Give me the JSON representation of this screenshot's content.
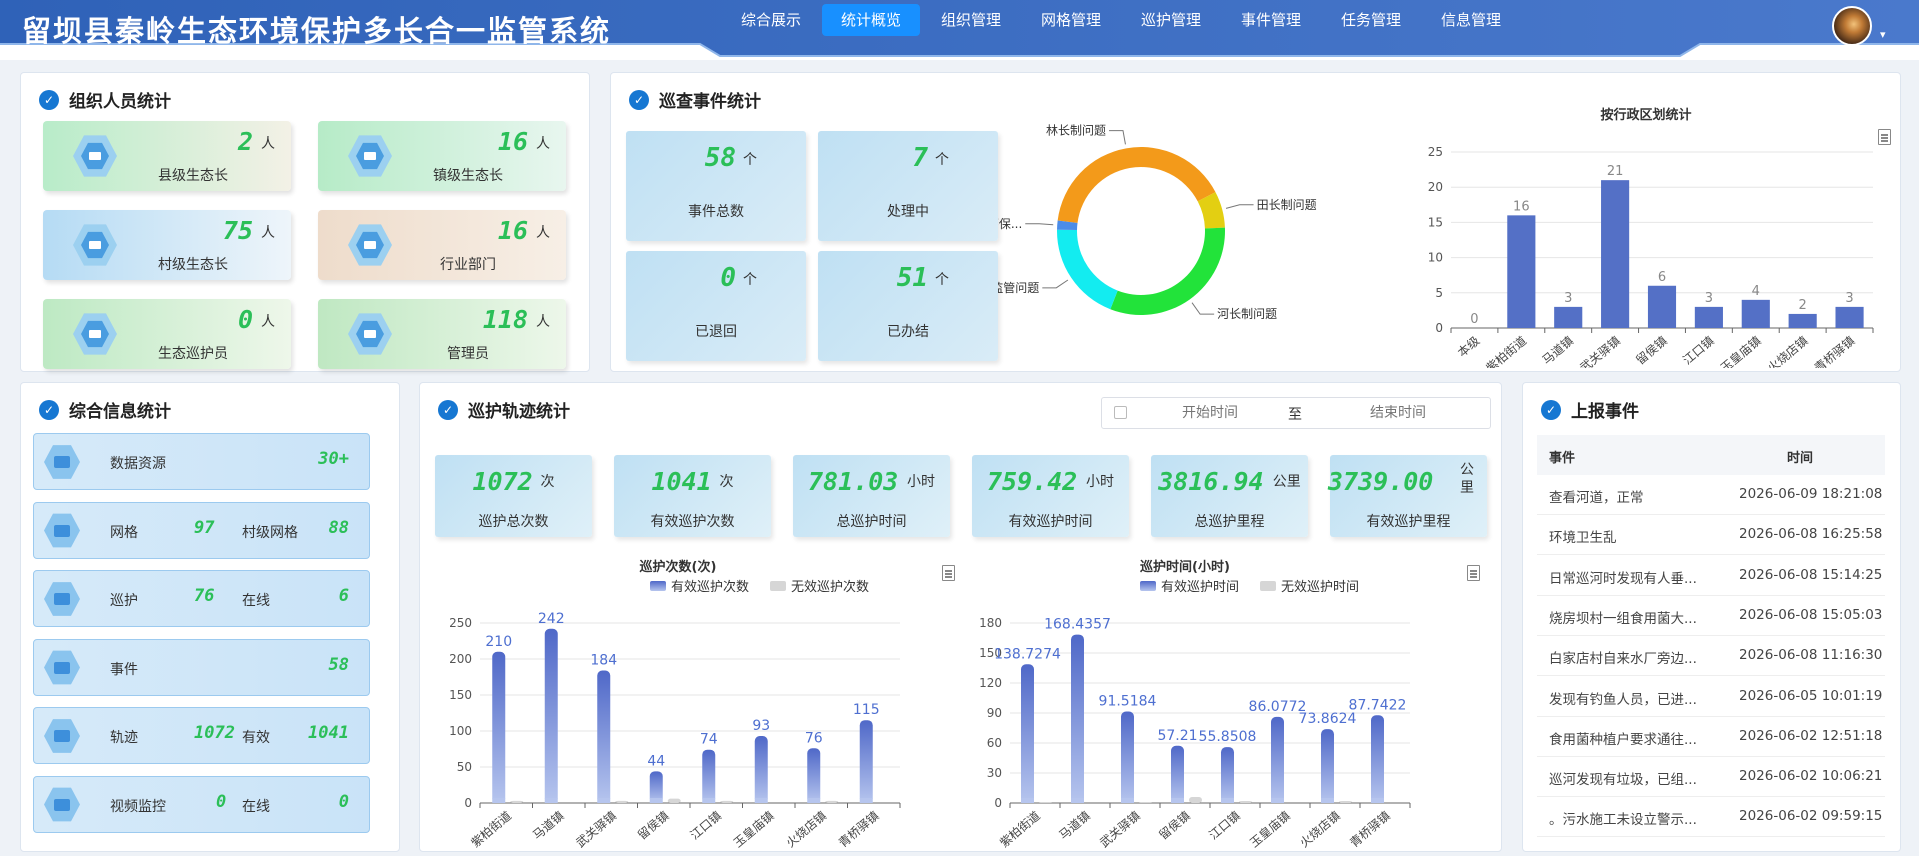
{
  "header": {
    "title": "留坝县秦岭生态环境保护多长合一监管系统",
    "nav": [
      {
        "label": "综合展示",
        "active": false
      },
      {
        "label": "统计概览",
        "active": true
      },
      {
        "label": "组织管理",
        "active": false
      },
      {
        "label": "网格管理",
        "active": false
      },
      {
        "label": "巡护管理",
        "active": false
      },
      {
        "label": "事件管理",
        "active": false
      },
      {
        "label": "任务管理",
        "active": false
      },
      {
        "label": "信息管理",
        "active": false
      }
    ],
    "colors": {
      "header_bg": "#3a6fc4",
      "nav_active": "#1890ff"
    }
  },
  "org": {
    "title": "组织人员统计",
    "cards": [
      {
        "value": "2",
        "unit": "人",
        "label": "县级生态长"
      },
      {
        "value": "16",
        "unit": "人",
        "label": "镇级生态长"
      },
      {
        "value": "75",
        "unit": "人",
        "label": "村级生态长"
      },
      {
        "value": "16",
        "unit": "人",
        "label": "行业部门"
      },
      {
        "value": "0",
        "unit": "人",
        "label": "生态巡护员"
      },
      {
        "value": "118",
        "unit": "人",
        "label": "管理员"
      }
    ]
  },
  "events": {
    "title": "巡查事件统计",
    "cards": [
      {
        "value": "58",
        "unit": "个",
        "label": "事件总数"
      },
      {
        "value": "7",
        "unit": "个",
        "label": "处理中"
      },
      {
        "value": "0",
        "unit": "个",
        "label": "已退回"
      },
      {
        "value": "51",
        "unit": "个",
        "label": "已办结"
      }
    ]
  },
  "info": {
    "title": "综合信息统计",
    "rows": [
      {
        "label1": "数据资源",
        "value1": "",
        "label2": "",
        "value2": "30+"
      },
      {
        "label1": "网格",
        "value1": "97",
        "label2": "村级网格",
        "value2": "88"
      },
      {
        "label1": "巡护",
        "value1": "76",
        "label2": "在线",
        "value2": "6"
      },
      {
        "label1": "事件",
        "value1": "",
        "label2": "",
        "value2": "58"
      },
      {
        "label1": "轨迹",
        "value1": "1072",
        "label2": "有效",
        "value2": "1041"
      },
      {
        "label1": "视频监控",
        "value1": "0",
        "label2": "在线",
        "value2": "0"
      }
    ]
  },
  "track": {
    "title": "巡护轨迹统计",
    "start_placeholder": "开始时间",
    "to": "至",
    "end_placeholder": "结束时间",
    "cards": [
      {
        "value": "1072",
        "unit": "次",
        "label": "巡护总次数"
      },
      {
        "value": "1041",
        "unit": "次",
        "label": "有效巡护次数"
      },
      {
        "value": "781.03",
        "unit": "小时",
        "label": "总巡护时间"
      },
      {
        "value": "759.42",
        "unit": "小时",
        "label": "有效巡护时间"
      },
      {
        "value": "3816.94",
        "unit": "公里",
        "label": "总巡护里程"
      },
      {
        "value": "3739.00",
        "unit": "公里",
        "label": "有效巡护里程"
      }
    ]
  },
  "reports": {
    "title": "上报事件",
    "col_event": "事件",
    "col_time": "时间",
    "rows": [
      {
        "event": "查看河道，正常",
        "time": "2026-06-09 18:21:08"
      },
      {
        "event": "环境卫生乱",
        "time": "2026-06-08 16:25:58"
      },
      {
        "event": "日常巡河时发现有人垂...",
        "time": "2026-06-08 15:14:25"
      },
      {
        "event": "烧房坝村一组食用菌大...",
        "time": "2026-06-08 15:05:03"
      },
      {
        "event": "白家店村自来水厂旁边...",
        "time": "2026-06-08 11:16:30"
      },
      {
        "event": "发现有钓鱼人员，已进...",
        "time": "2026-06-05 10:01:19"
      },
      {
        "event": "食用菌种植户要求通往...",
        "time": "2026-06-02 12:51:18"
      },
      {
        "event": "巡河发现有垃圾，已组...",
        "time": "2026-06-02 10:06:21"
      },
      {
        "event": "。污水施工未设立警示...",
        "time": "2026-06-02 09:59:15"
      }
    ]
  },
  "chart_data": [
    {
      "type": "pie",
      "variant": "donut",
      "series": [
        {
          "name": "林长制问题",
          "value": 23,
          "color": "#f39a1a"
        },
        {
          "name": "田长制问题",
          "value": 4,
          "color": "#e3cf12"
        },
        {
          "name": "河长制问题",
          "value": 18,
          "color": "#22e33a"
        },
        {
          "name": "秦岭监管问题",
          "value": 11,
          "color": "#13ecf0"
        },
        {
          "name": "生态环保...",
          "value": 1,
          "color": "#4b8ce8"
        }
      ]
    },
    {
      "type": "bar",
      "title": "按行政区划统计",
      "categories": [
        "本级",
        "紫柏街道",
        "马道镇",
        "武关驿镇",
        "留侯镇",
        "江口镇",
        "玉皇庙镇",
        "火烧店镇",
        "青桥驿镇"
      ],
      "values": [
        0,
        16,
        3,
        21,
        6,
        3,
        4,
        2,
        3
      ],
      "ylim": [
        0,
        25
      ],
      "yticks": [
        0,
        5,
        10,
        15,
        20,
        25
      ],
      "color": "#5470c6"
    },
    {
      "type": "bar",
      "title": "巡护次数(次)",
      "categories": [
        "紫柏街道",
        "马道镇",
        "武关驿镇",
        "留侯镇",
        "江口镇",
        "玉皇庙镇",
        "火烧店镇",
        "青桥驿镇"
      ],
      "series": [
        {
          "name": "有效巡护次数",
          "values": [
            210,
            242,
            184,
            44,
            74,
            93,
            76,
            115
          ],
          "color": "#5d78d0"
        },
        {
          "name": "无效巡护次数",
          "values": [
            3,
            0,
            3,
            6,
            3,
            0,
            3,
            0
          ],
          "color": "#d6d6d6"
        }
      ],
      "ylim": [
        0,
        250
      ],
      "yticks": [
        0,
        50,
        100,
        150,
        200,
        250
      ]
    },
    {
      "type": "bar",
      "title": "巡护时间(小时)",
      "categories": [
        "紫柏街道",
        "马道镇",
        "武关驿镇",
        "留侯镇",
        "江口镇",
        "玉皇庙镇",
        "火烧店镇",
        "青桥驿镇"
      ],
      "series": [
        {
          "name": "有效巡护时间",
          "values": [
            138.7274,
            168.4357,
            91.5184,
            57.21,
            55.8508,
            86.0772,
            73.8624,
            87.7422
          ],
          "color": "#5d78d0"
        },
        {
          "name": "无效巡护时间",
          "values": [
            1,
            0,
            1,
            6,
            2,
            0,
            2,
            0
          ],
          "color": "#d6d6d6"
        }
      ],
      "value_labels": [
        "138.7274",
        "168.4357",
        "91.5184",
        "57.21",
        "55.8508",
        "86.0772",
        "73.8624",
        "87.7422"
      ],
      "ylim": [
        0,
        180
      ],
      "yticks": [
        0,
        30,
        60,
        90,
        120,
        150,
        180
      ]
    }
  ]
}
